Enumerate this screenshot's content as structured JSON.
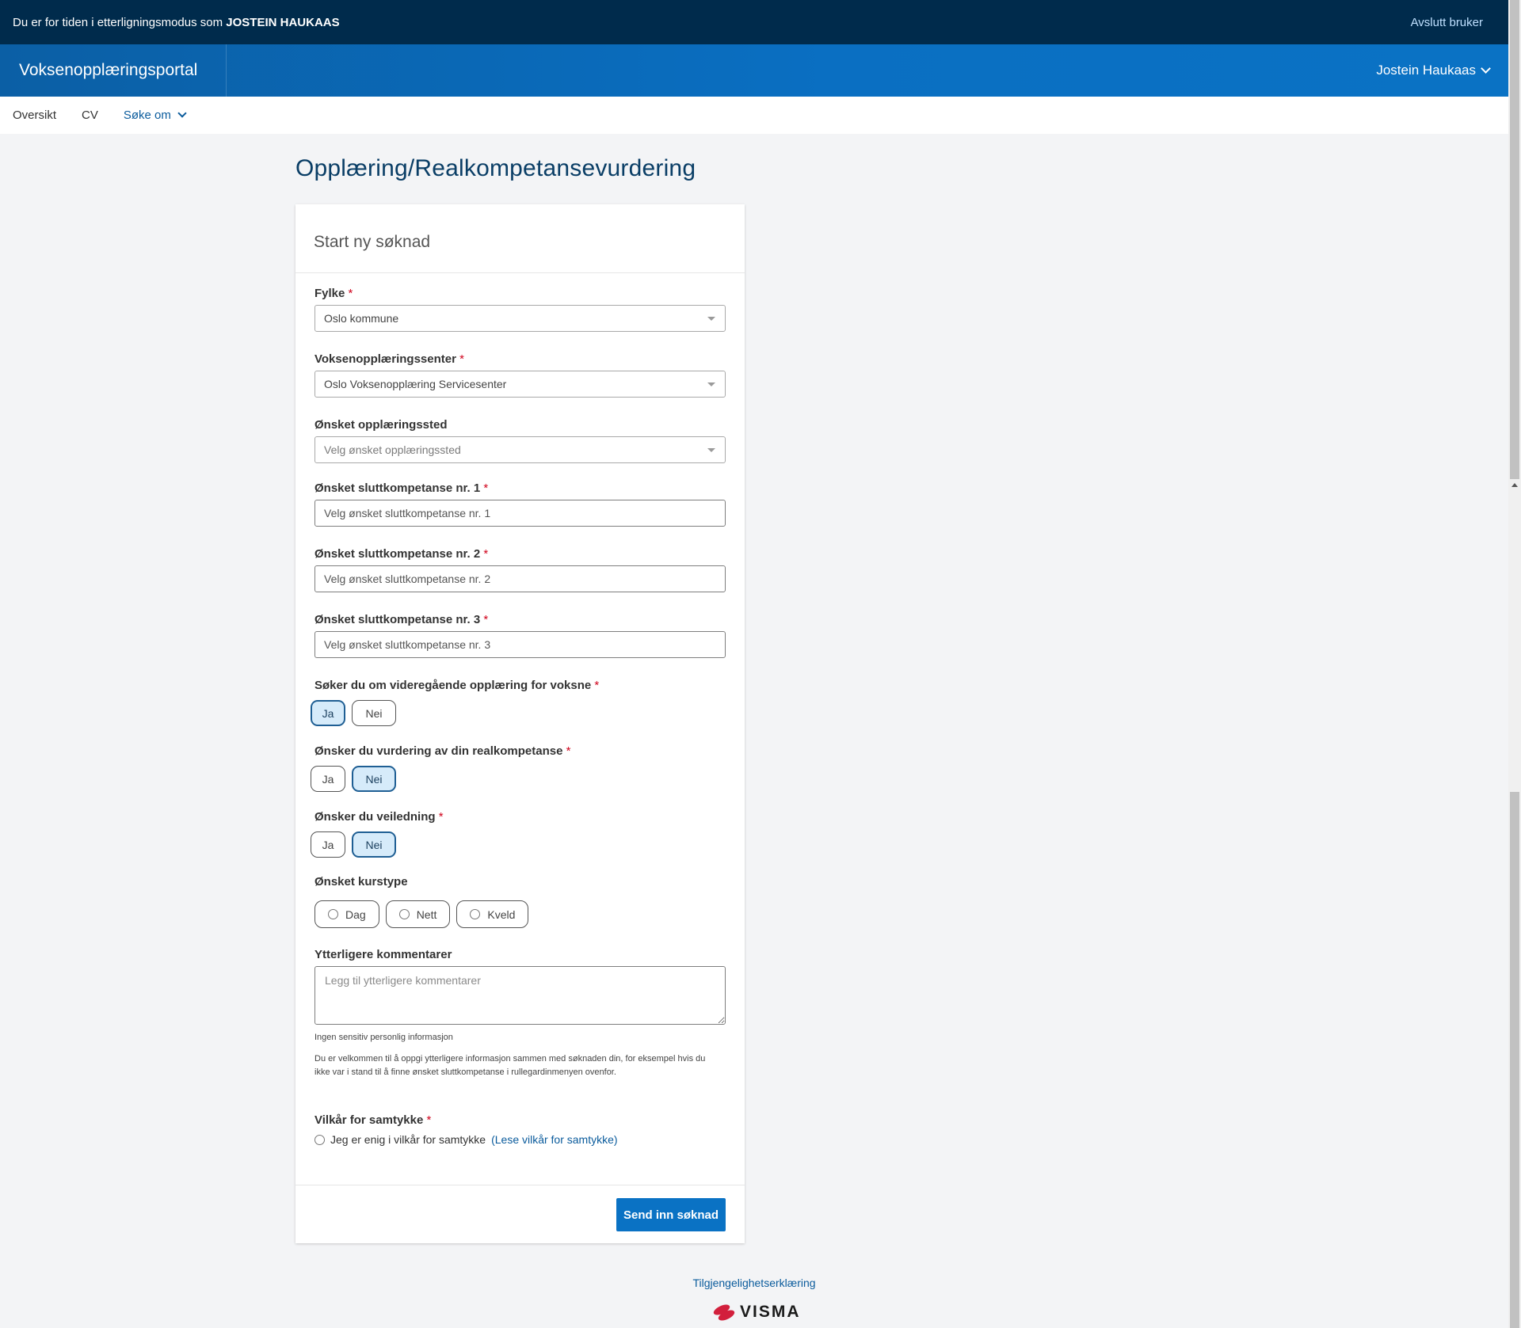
{
  "impersonation": {
    "message_prefix": "Du er for tiden i etterligningsmodus som",
    "user_name": "JOSTEIN HAUKAAS",
    "end_label": "Avslutt bruker"
  },
  "header": {
    "brand": "Voksenopplæringsportal",
    "user_name": "Jostein Haukaas"
  },
  "subnav": {
    "items": [
      "Oversikt",
      "CV",
      "Søke om"
    ]
  },
  "page": {
    "title": "Opplæring/Realkompetansevurdering"
  },
  "card": {
    "title": "Start ny søknad"
  },
  "form": {
    "required_marker": "*",
    "fylke": {
      "label": "Fylke",
      "value": "Oslo kommune"
    },
    "senter": {
      "label": "Voksenopplæringssenter",
      "value": "Oslo Voksenopplæring Servicesenter"
    },
    "sted": {
      "label": "Ønsket opplæringssted",
      "placeholder": "Velg ønsket opplæringssted"
    },
    "kompetanse1": {
      "label": "Ønsket sluttkompetanse nr. 1",
      "placeholder": "Velg ønsket sluttkompetanse nr. 1"
    },
    "kompetanse2": {
      "label": "Ønsket sluttkompetanse nr. 2",
      "placeholder": "Velg ønsket sluttkompetanse nr. 2"
    },
    "kompetanse3": {
      "label": "Ønsket sluttkompetanse nr. 3",
      "placeholder": "Velg ønsket sluttkompetanse nr. 3"
    },
    "videregaende": {
      "label": "Søker du om videregående opplæring for voksne",
      "yes": "Ja",
      "no": "Nei",
      "selected": "Ja"
    },
    "realkompetanse": {
      "label": "Ønsker du vurdering av din realkompetanse",
      "yes": "Ja",
      "no": "Nei",
      "selected": "Nei"
    },
    "veiledning": {
      "label": "Ønsker du veiledning",
      "yes": "Ja",
      "no": "Nei",
      "selected": "Nei"
    },
    "kurstype": {
      "label": "Ønsket kurstype",
      "options": [
        "Dag",
        "Nett",
        "Kveld"
      ]
    },
    "kommentarer": {
      "label": "Ytterligere kommentarer",
      "placeholder": "Legg til ytterligere kommentarer",
      "hint": "Ingen sensitiv personlig informasjon",
      "info": "Du er velkommen til å oppgi ytterligere informasjon sammen med søknaden din, for eksempel hvis du ikke var i stand til å finne ønsket sluttkompetanse i rullegardinmenyen ovenfor."
    },
    "samtykke": {
      "label": "Vilkår for samtykke",
      "text": "Jeg er enig i vilkår for samtykke",
      "link": "(Lese vilkår for samtykke)"
    },
    "submit_label": "Send inn søknad"
  },
  "footer": {
    "link": "Tilgjengelighetserklæring",
    "logo_text": "VISMA"
  },
  "colors": {
    "banner": "#002b4c",
    "header": "#0a72c4",
    "accent": "#0a5b9c",
    "required": "#d0021b",
    "selected_toggle": "#d6ebfa"
  }
}
